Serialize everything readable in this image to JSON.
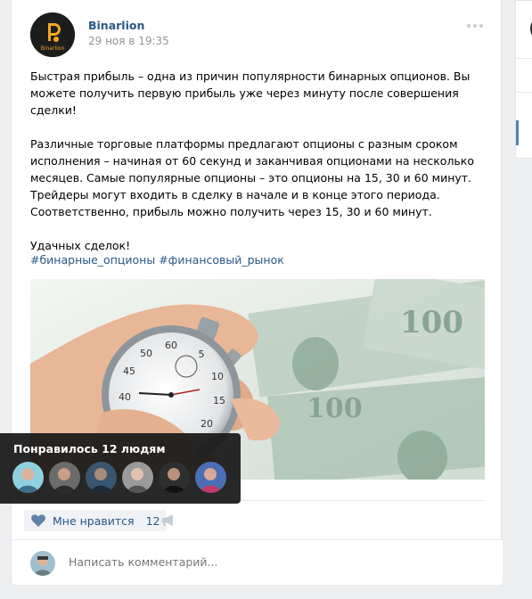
{
  "post": {
    "author": "Binarlion",
    "date": "29 ноя в 19:35",
    "logo_text": "Binarlion",
    "paragraphs": [
      "Быстрая прибыль – одна из причин популярности бинарных опционов. Вы можете получить первую прибыль уже через минуту после совершения сделки!",
      "Различные торговые платформы предлагают опционы с разным сроком исполнения – начиная от 60 секунд и заканчивая опционами на несколько месяцев. Самые популярные опционы – это опционы на 15, 30 и 60 минут. Трейдеры могут входить в сделку в начале и в конце этого периода. Соответственно, прибыль можно получить через 15, 30 и 60 минут.",
      "Удачных сделок!"
    ],
    "hashtags": [
      "#бинарные_опционы",
      "#финансовый_рынок"
    ],
    "photo_icon": "stopwatch-and-dollars-photo"
  },
  "actions": {
    "like_label": "Мне нравится",
    "like_count": "12",
    "like_icon": "heart-icon",
    "share_icon": "megaphone-icon"
  },
  "comment": {
    "placeholder": "Написать комментарий..."
  },
  "tooltip": {
    "title": "Понравилось 12 людям",
    "likers": 6
  },
  "colors": {
    "link": "#2a5885",
    "background": "#edeef0",
    "tooltip_bg": "#181818"
  }
}
